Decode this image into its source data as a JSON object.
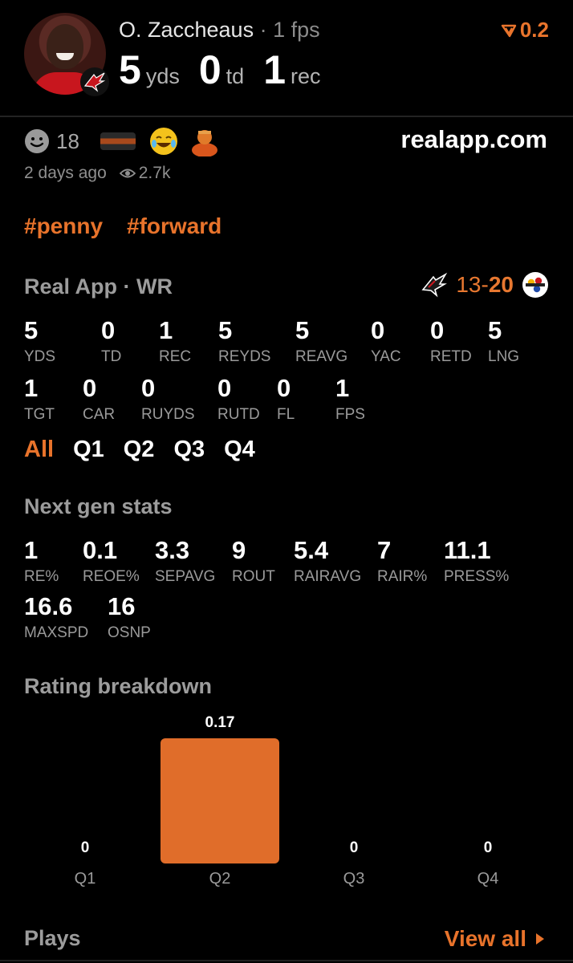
{
  "header": {
    "player_name": "O. Zaccheaus",
    "fps_text": "· 1 fps",
    "rating": "0.2",
    "headline": [
      {
        "value": "5",
        "unit": "yds"
      },
      {
        "value": "0",
        "unit": "td"
      },
      {
        "value": "1",
        "unit": "rec"
      }
    ]
  },
  "reactions": {
    "count": "18",
    "domain": "realapp.com",
    "time_ago": "2 days ago",
    "views": "2.7k"
  },
  "tags": [
    "#penny",
    "#forward"
  ],
  "game": {
    "title": "Real App · WR",
    "score_team": "13",
    "score_dash": "-",
    "score_opp": "20"
  },
  "stats_row1": [
    {
      "value": "5",
      "label": "YDS"
    },
    {
      "value": "0",
      "label": "TD"
    },
    {
      "value": "1",
      "label": "REC"
    },
    {
      "value": "5",
      "label": "REYDS"
    },
    {
      "value": "5",
      "label": "REAVG"
    },
    {
      "value": "0",
      "label": "YAC"
    },
    {
      "value": "0",
      "label": "RETD"
    },
    {
      "value": "5",
      "label": "LNG"
    }
  ],
  "stats_row2": [
    {
      "value": "1",
      "label": "TGT"
    },
    {
      "value": "0",
      "label": "CAR"
    },
    {
      "value": "0",
      "label": "RUYDS"
    },
    {
      "value": "0",
      "label": "RUTD"
    },
    {
      "value": "0",
      "label": "FL"
    },
    {
      "value": "1",
      "label": "FPS"
    }
  ],
  "periods": [
    "All",
    "Q1",
    "Q2",
    "Q3",
    "Q4"
  ],
  "next_gen": {
    "title": "Next gen stats",
    "row1": [
      {
        "value": "1",
        "label": "RE%"
      },
      {
        "value": "0.1",
        "label": "REOE%"
      },
      {
        "value": "3.3",
        "label": "SEPAVG"
      },
      {
        "value": "9",
        "label": "ROUT"
      },
      {
        "value": "5.4",
        "label": "RAIRAVG"
      },
      {
        "value": "7",
        "label": "RAIR%"
      },
      {
        "value": "11.1",
        "label": "PRESS%"
      }
    ],
    "row2": [
      {
        "value": "16.6",
        "label": "MAXSPD"
      },
      {
        "value": "16",
        "label": "OSNP"
      }
    ]
  },
  "rating_breakdown": {
    "title": "Rating breakdown"
  },
  "chart_data": {
    "type": "bar",
    "categories": [
      "Q1",
      "Q2",
      "Q3",
      "Q4"
    ],
    "values": [
      0,
      0.17,
      0,
      0
    ],
    "value_labels": [
      "0",
      "0.17",
      "0",
      "0"
    ],
    "title": "",
    "xlabel": "",
    "ylabel": "",
    "ylim": [
      0,
      0.17
    ],
    "grid": false,
    "color": "#e06d2a"
  },
  "footer": {
    "title": "Plays",
    "view_all": "View all"
  },
  "colors": {
    "accent": "#e8732b",
    "background": "#000000",
    "muted": "#9a9a9a"
  }
}
